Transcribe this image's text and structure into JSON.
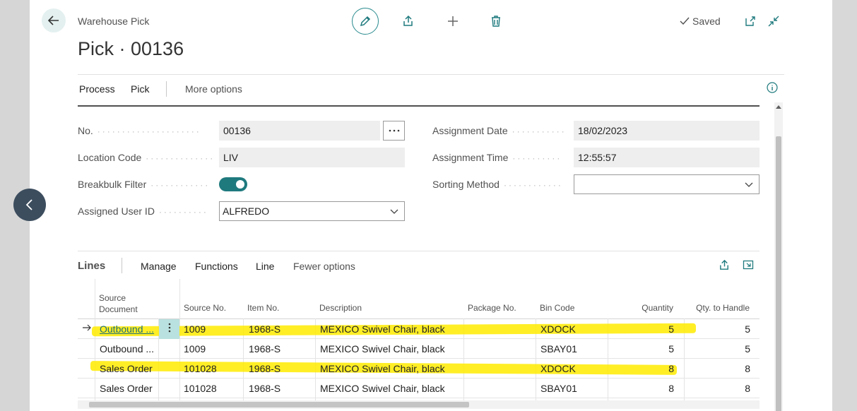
{
  "header": {
    "caption": "Warehouse Pick",
    "title": "Pick · 00136",
    "status": "Saved"
  },
  "actions": {
    "process": "Process",
    "pick": "Pick",
    "more": "More options"
  },
  "fields": {
    "no": {
      "label": "No.",
      "value": "00136"
    },
    "location_code": {
      "label": "Location Code",
      "value": "LIV"
    },
    "breakbulk_filter": {
      "label": "Breakbulk Filter",
      "value": true
    },
    "assigned_user_id": {
      "label": "Assigned User ID",
      "value": "ALFREDO"
    },
    "assignment_date": {
      "label": "Assignment Date",
      "value": "18/02/2023"
    },
    "assignment_time": {
      "label": "Assignment Time",
      "value": "12:55:57"
    },
    "sorting_method": {
      "label": "Sorting Method",
      "value": ""
    }
  },
  "lines": {
    "title": "Lines",
    "actions": {
      "manage": "Manage",
      "functions": "Functions",
      "line": "Line",
      "fewer": "Fewer options"
    },
    "headers": {
      "source_document_1": "Source",
      "source_document_2": "Document",
      "source_no": "Source No.",
      "item_no": "Item No.",
      "description": "Description",
      "package_no": "Package No.",
      "bin_code": "Bin Code",
      "quantity": "Quantity",
      "qty_to_handle": "Qty. to Handle"
    },
    "rows": [
      {
        "source_document": "Outbound ...",
        "source_no": "1009",
        "item_no": "1968-S",
        "description": "MEXICO Swivel Chair, black",
        "package_no": "",
        "bin_code": "XDOCK",
        "quantity": "5",
        "qty_to_handle": "5"
      },
      {
        "source_document": "Outbound ...",
        "source_no": "1009",
        "item_no": "1968-S",
        "description": "MEXICO Swivel Chair, black",
        "package_no": "",
        "bin_code": "SBAY01",
        "quantity": "5",
        "qty_to_handle": "5"
      },
      {
        "source_document": "Sales Order",
        "source_no": "101028",
        "item_no": "1968-S",
        "description": "MEXICO Swivel Chair, black",
        "package_no": "",
        "bin_code": "XDOCK",
        "quantity": "8",
        "qty_to_handle": "8"
      },
      {
        "source_document": "Sales Order",
        "source_no": "101028",
        "item_no": "1968-S",
        "description": "MEXICO Swivel Chair, black",
        "package_no": "",
        "bin_code": "SBAY01",
        "quantity": "8",
        "qty_to_handle": "8"
      }
    ]
  },
  "colors": {
    "accent": "#1f7a7e",
    "highlight": "#ffeb00"
  },
  "icons": [
    "back-arrow-icon",
    "pencil-icon",
    "share-icon",
    "plus-icon",
    "trash-icon",
    "check-icon",
    "open-new-window-icon",
    "collapse-icon",
    "info-icon",
    "ellipsis-icon",
    "chevron-down-icon",
    "chevron-left-icon",
    "row-arrow-icon",
    "row-menu-icon"
  ]
}
